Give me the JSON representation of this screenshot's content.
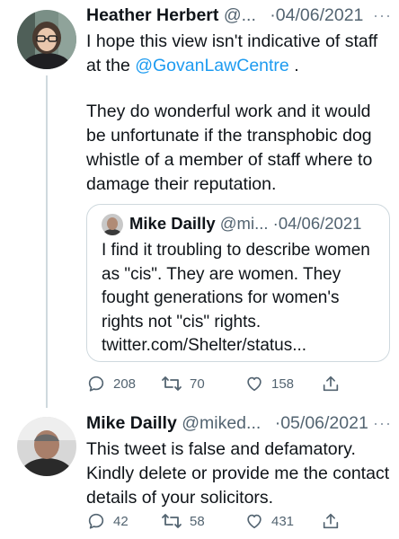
{
  "tweets": [
    {
      "author_name": "Heather Herbert",
      "handle": "@...",
      "date": "·04/06/2021",
      "more": "···",
      "text_pre": "I hope this view isn't indicative of staff at the ",
      "mention": "@GovanLawCentre",
      "text_post": " .",
      "text_2": "They do wonderful work and it would be unfortunate if the transphobic dog whistle of a member of staff where to damage their reputation.",
      "quote": {
        "author_name": "Mike Dailly",
        "handle": "@mi...",
        "date": "·04/06/2021",
        "text": "I find it troubling to describe women as \"cis\". They are women. They fought generations for women's rights not \"cis\" rights. twitter.com/Shelter/status..."
      },
      "replies": "208",
      "retweets": "70",
      "likes": "158"
    },
    {
      "author_name": "Mike Dailly",
      "handle": "@miked...",
      "date": "·05/06/2021",
      "more": "···",
      "text": "This tweet is false and defamatory. Kindly delete or provide me the contact details of your solicitors.",
      "replies": "42",
      "retweets": "58",
      "likes": "431"
    }
  ],
  "colors": {
    "link": "#1d9bf0",
    "muted": "#536471",
    "border": "#cfd9de"
  },
  "icons": [
    "reply-icon",
    "retweet-icon",
    "like-icon",
    "share-icon",
    "more-icon"
  ]
}
